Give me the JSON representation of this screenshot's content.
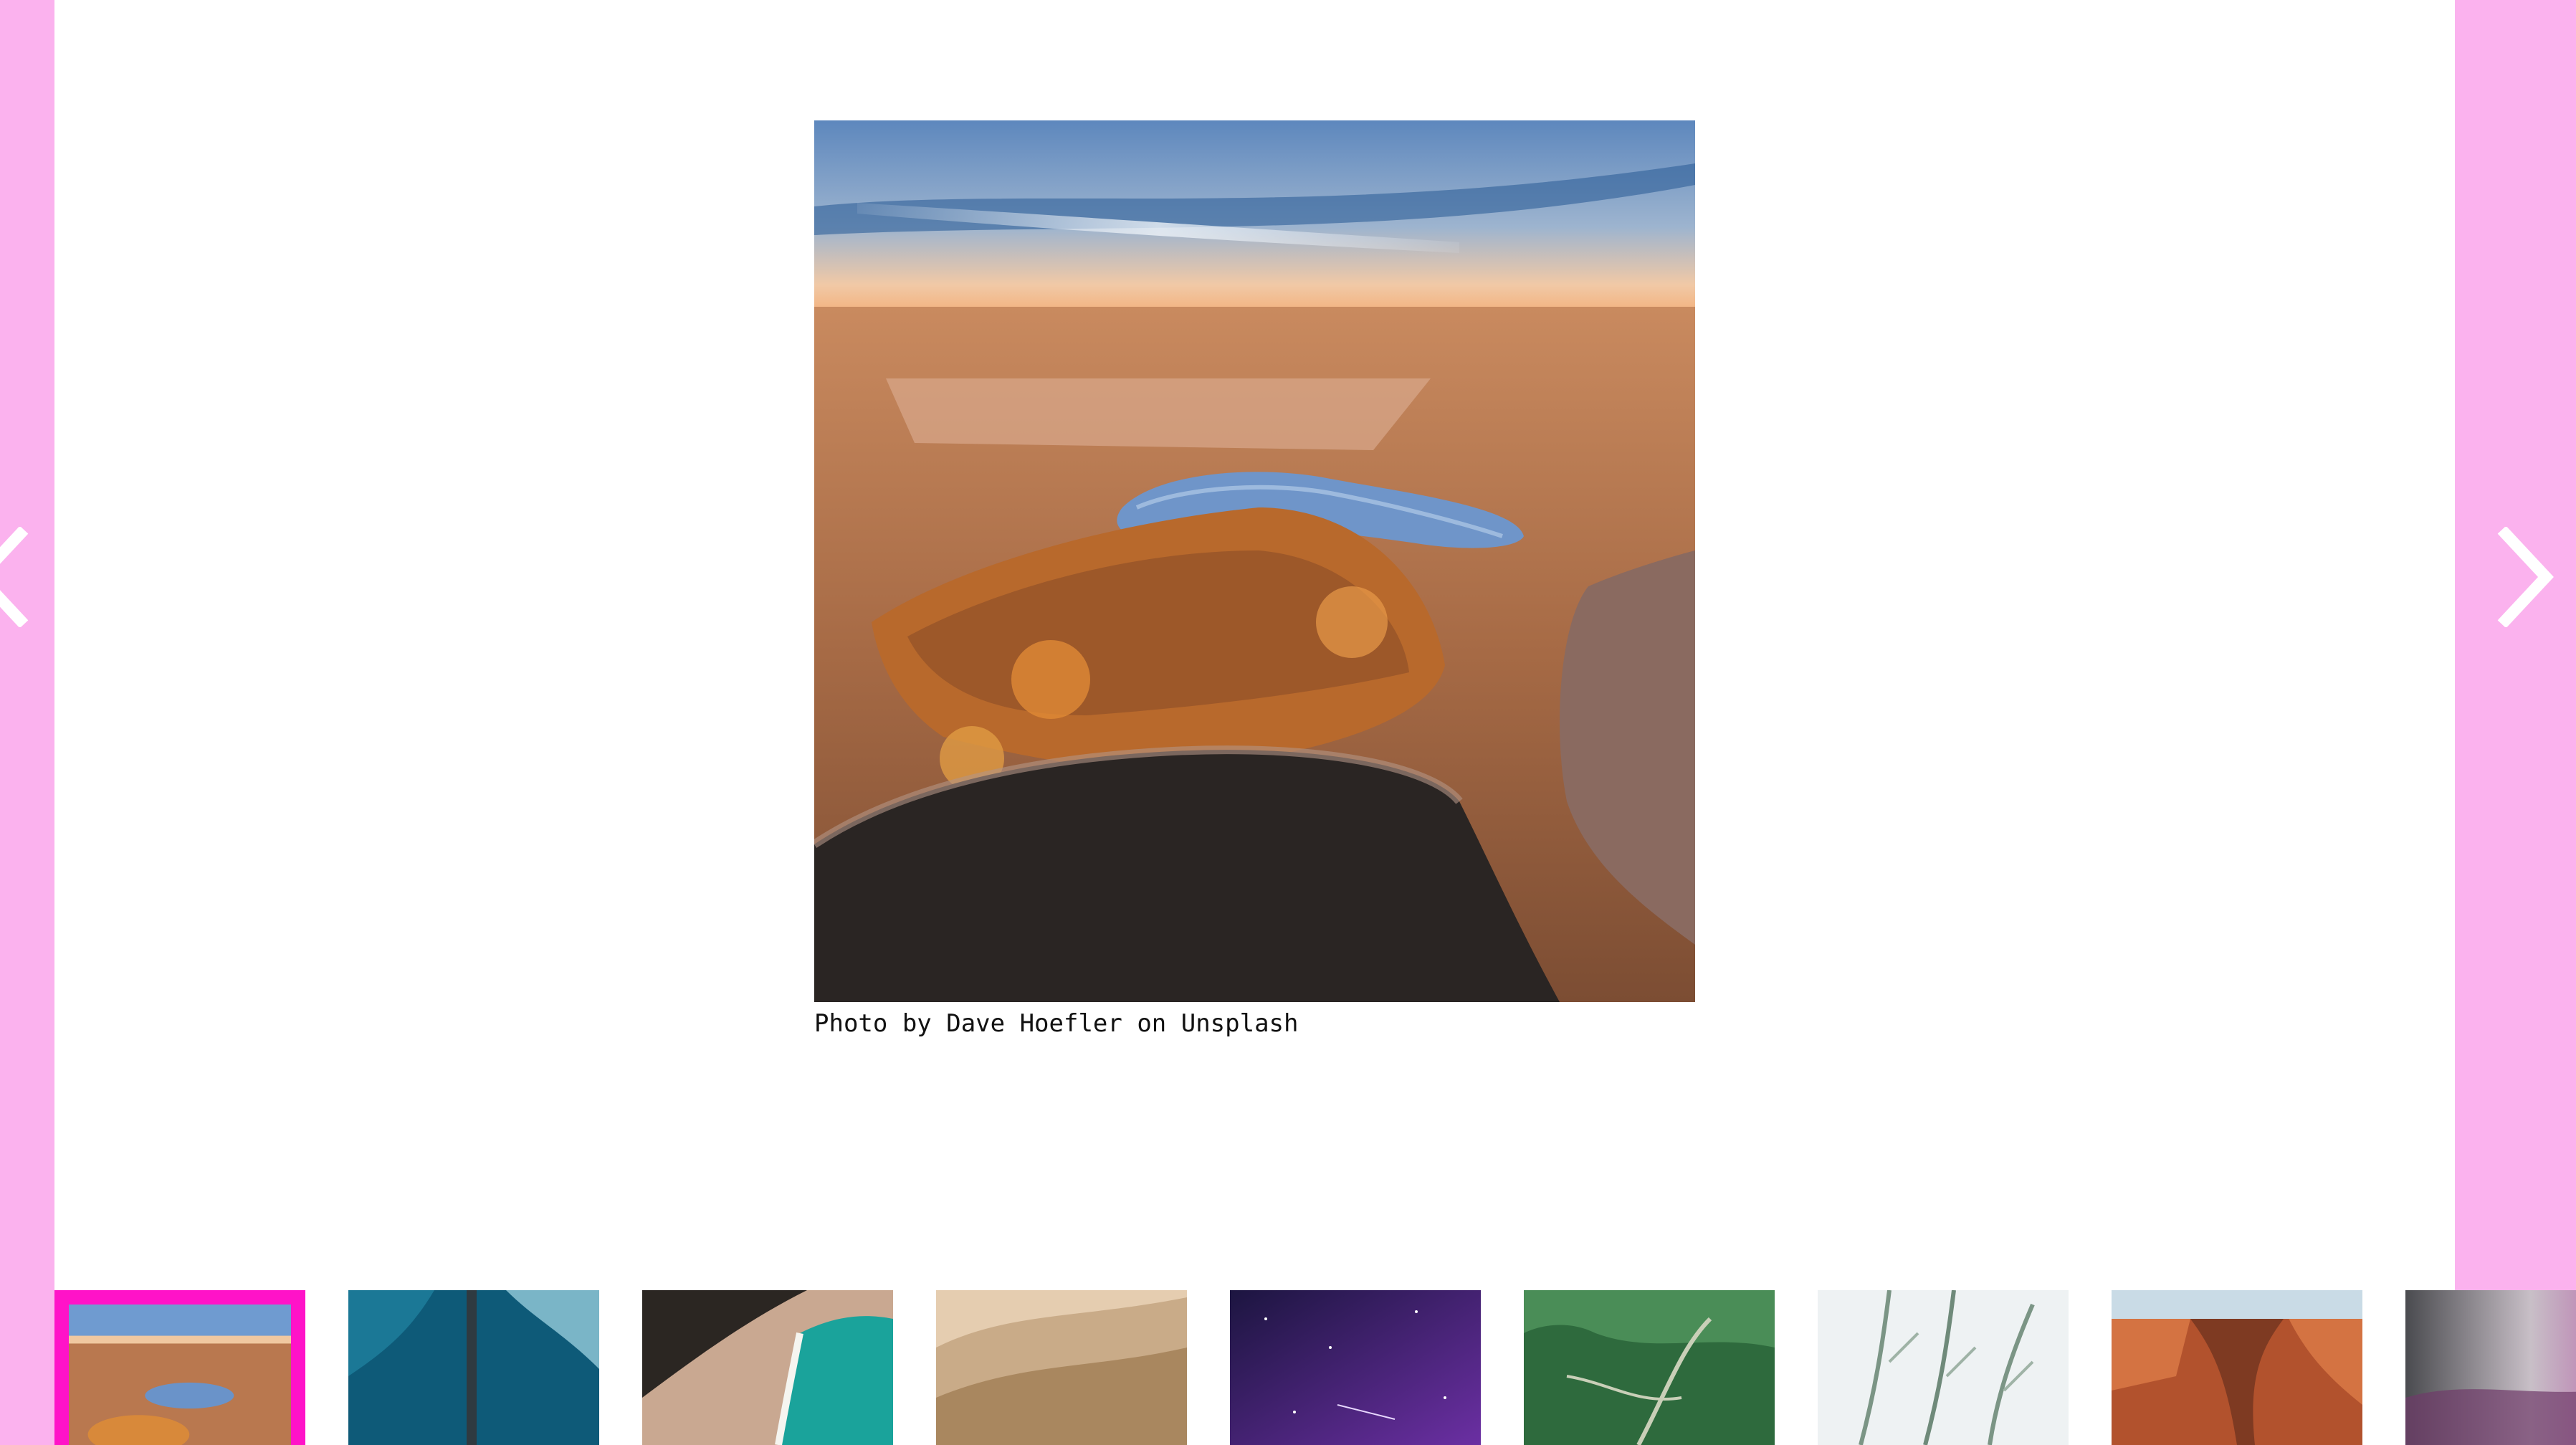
{
  "gallery": {
    "caption": "Photo by Dave Hoefler on Unsplash",
    "prev_icon": "chevron-left-icon",
    "next_icon": "chevron-right-icon",
    "selected_index": 0,
    "colors": {
      "side_panel": "#fbb2ee",
      "selection_border": "#ff13c8",
      "arrow": "#ffffff"
    }
  },
  "thumbnails": [
    {
      "subject": "autumn aerial landscape with lakes",
      "selected": true
    },
    {
      "subject": "ocean waves aerial with pier",
      "selected": false
    },
    {
      "subject": "beach coastline aerial",
      "selected": false
    },
    {
      "subject": "sand dunes",
      "selected": false
    },
    {
      "subject": "purple starry night sky",
      "selected": false
    },
    {
      "subject": "green hills with winding road",
      "selected": false
    },
    {
      "subject": "frosted plant leaves",
      "selected": false
    },
    {
      "subject": "red rock canyon",
      "selected": false
    },
    {
      "subject": "misty purple landscape",
      "selected": false
    }
  ]
}
